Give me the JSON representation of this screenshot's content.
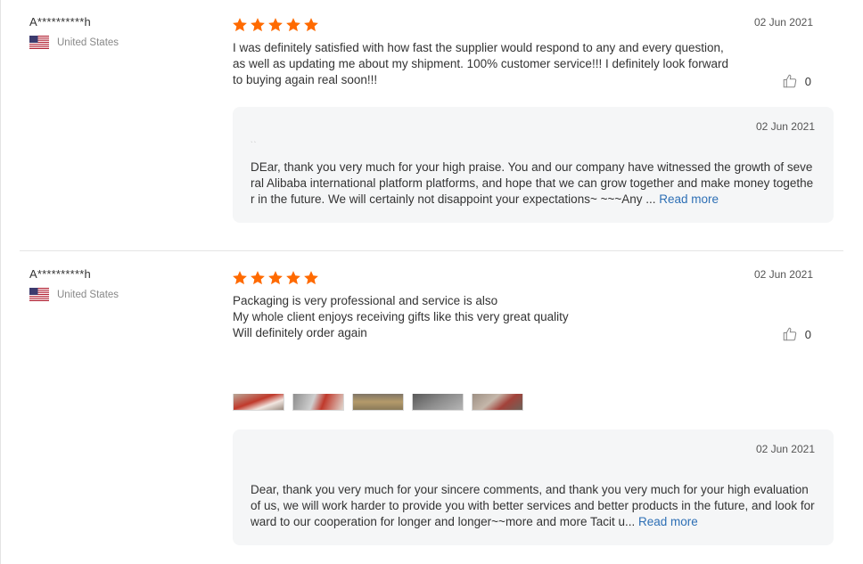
{
  "colors": {
    "star": "#ff6a00",
    "link": "#2d6fb5",
    "reply_bg": "#f5f6f7"
  },
  "reviews": [
    {
      "user": "A**********h",
      "country": "United States",
      "rating": 5,
      "date": "02 Jun 2021",
      "text": "I was definitely satisfied with how fast the supplier would respond to any and every question, as well as updating me about my shipment. 100% customer service!!! I definitely look forward to buying again real soon!!!",
      "likes": "0",
      "reply": {
        "date": "02 Jun 2021",
        "text": "DEar, thank you very much for your high praise. You and our company have witnessed the growth of several Alibaba international platform platforms, and hope that we can grow together and make money together in the future. We will certainly not disappoint your expectations~ ~~~Any ...",
        "read_more": "Read more"
      }
    },
    {
      "user": "A**********h",
      "country": "United States",
      "rating": 5,
      "date": "02 Jun 2021",
      "text_lines": [
        "Packaging is very professional and service is also",
        "My whole client enjoys receiving gifts like this very great quality",
        "Will definitely order again"
      ],
      "likes": "0",
      "photos": [
        "photo-1",
        "photo-2",
        "photo-3",
        "photo-4",
        "photo-5"
      ],
      "reply": {
        "date": "02 Jun 2021",
        "text": "Dear, thank you very much for your sincere comments, and thank you very much for your high evaluation of us, we will work harder to provide you with better services and better products in the future, and look forward to our cooperation for longer and longer~~more and more Tacit u...",
        "read_more": "Read more"
      }
    }
  ]
}
